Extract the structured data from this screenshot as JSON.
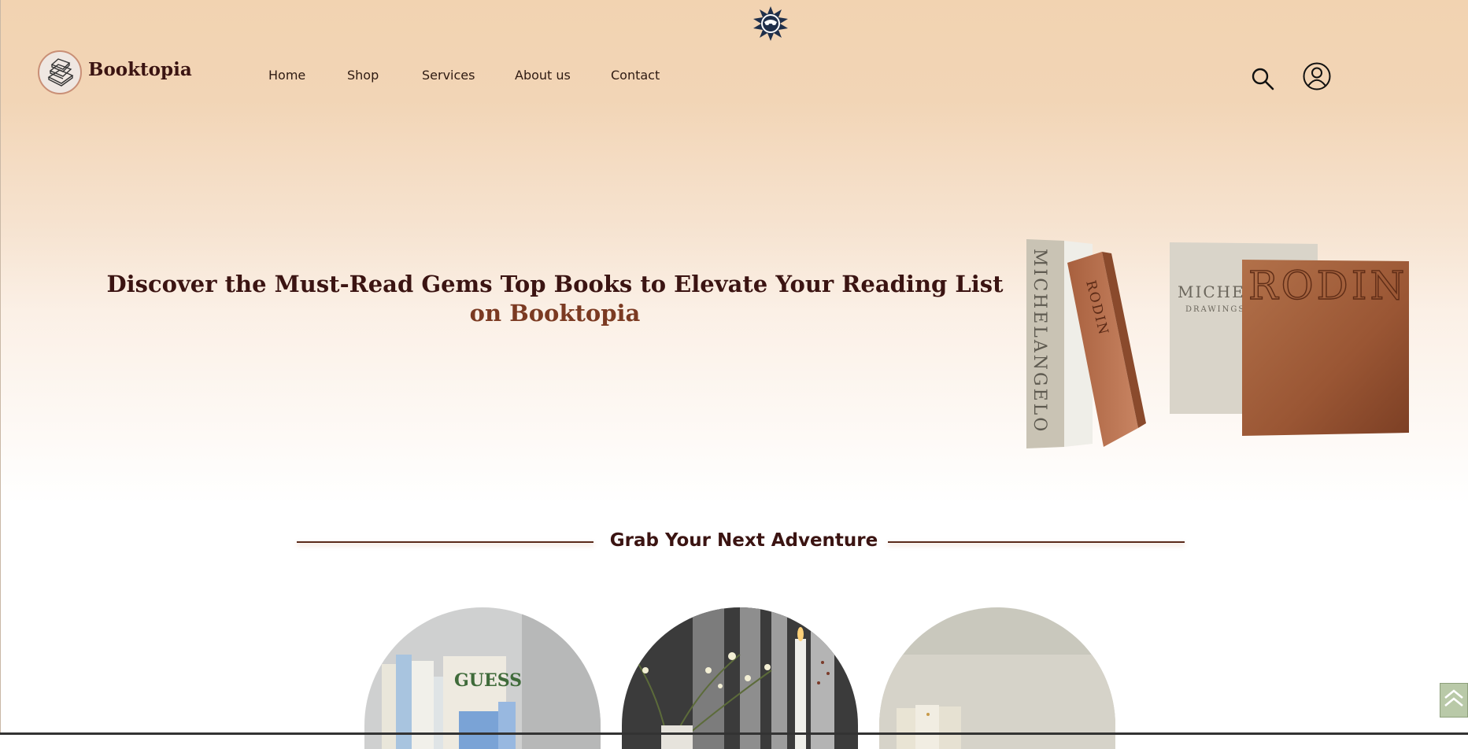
{
  "brand": {
    "name": "Booktopia",
    "logo_icon": "stacked-books-icon",
    "emblem_icon": "compass-emblem-icon"
  },
  "nav": {
    "items": [
      {
        "label": "Home"
      },
      {
        "label": "Shop"
      },
      {
        "label": "Services"
      },
      {
        "label": "About us"
      },
      {
        "label": "Contact"
      }
    ]
  },
  "header_icons": {
    "search": "search-icon",
    "account": "user-icon"
  },
  "hero": {
    "headline": "Discover the Must-Read Gems Top Books to Elevate Your Reading List",
    "headline_accent": "on Booktopia",
    "image": {
      "books": [
        {
          "spine_title": "MICHELANGELO"
        },
        {
          "spine_title": "RODIN"
        },
        {
          "cover_title": "MICHEL",
          "cover_subtitle": "DRAWINGS &"
        },
        {
          "cover_title": "RODIN"
        }
      ]
    }
  },
  "section": {
    "title": "Grab Your Next Adventure",
    "cards": [
      {
        "book_label": "GUESS"
      },
      {
        "name": "flowers-candles-card"
      },
      {
        "name": "beige-books-card"
      }
    ]
  },
  "scroll_top": {
    "icon": "chevron-up-icon"
  },
  "colors": {
    "hero_top": "#f2d3b1",
    "brand_dark": "#3b1412",
    "accent_brown": "#7b3a22",
    "rule": "#5a2a1a",
    "scroll_btn": "#b9c9a8"
  }
}
